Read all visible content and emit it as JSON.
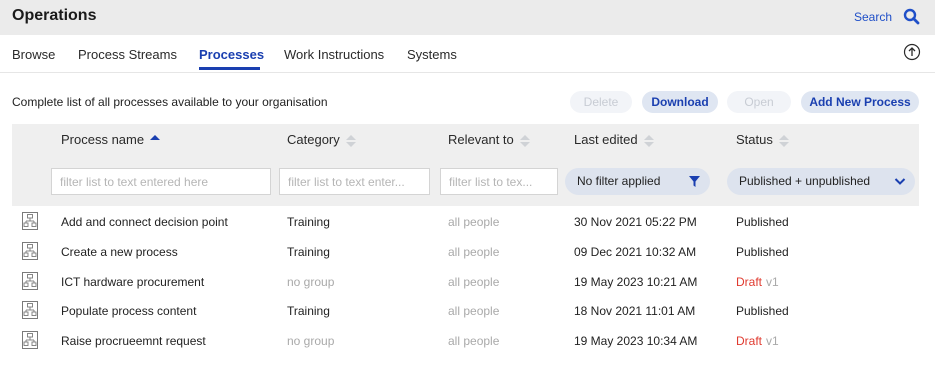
{
  "app": {
    "title": "Operations",
    "search_label": "Search"
  },
  "tabs": [
    {
      "label": "Browse"
    },
    {
      "label": "Process Streams"
    },
    {
      "label": "Processes"
    },
    {
      "label": "Work Instructions"
    },
    {
      "label": "Systems"
    }
  ],
  "active_tab": "Processes",
  "toolbar": {
    "caption": "Complete list of all processes available to your organisation",
    "delete_label": "Delete",
    "download_label": "Download",
    "open_label": "Open",
    "add_label": "Add New Process"
  },
  "columns": [
    {
      "label": "Process name",
      "sort": "ascending"
    },
    {
      "label": "Category",
      "sort": "none"
    },
    {
      "label": "Relevant to",
      "sort": "none"
    },
    {
      "label": "Last edited",
      "sort": "none"
    },
    {
      "label": "Status",
      "sort": "none"
    }
  ],
  "filters": {
    "name_placeholder": "filter list to text entered here",
    "category_placeholder": "filter list to text enter...",
    "relevant_placeholder": "filter list to tex...",
    "last_edited_value": "No filter applied",
    "status_value": "Published + unpublished"
  },
  "rows": [
    {
      "name": "Add and connect decision point",
      "category": "Training",
      "relevant": "all people",
      "edited": "30 Nov 2021 05:22 PM",
      "status": "Published",
      "version": ""
    },
    {
      "name": "Create a new process",
      "category": "Training",
      "relevant": "all people",
      "edited": "09 Dec 2021 10:32 AM",
      "status": "Published",
      "version": ""
    },
    {
      "name": "ICT hardware procurement",
      "category": "no group",
      "relevant": "all people",
      "edited": "19 May 2023 10:21 AM",
      "status": "Draft",
      "version": "v1"
    },
    {
      "name": "Populate process content",
      "category": "Training",
      "relevant": "all people",
      "edited": "18 Nov 2021 11:01 AM",
      "status": "Published",
      "version": ""
    },
    {
      "name": "Raise procrueemnt request",
      "category": "no group",
      "relevant": "all people",
      "edited": "19 May 2023 10:34 AM",
      "status": "Draft",
      "version": "v1"
    }
  ],
  "colors": {
    "accent": "#1a3fb0",
    "draft": "#e03a2f",
    "muted": "#a9a9a9",
    "header_bg": "#ebebeb"
  },
  "icons": {
    "search": "search-icon",
    "upload": "upload-icon",
    "filter": "filter-icon",
    "chevron": "chevron-down-icon",
    "process": "process-icon",
    "sort": "sort-icon"
  }
}
